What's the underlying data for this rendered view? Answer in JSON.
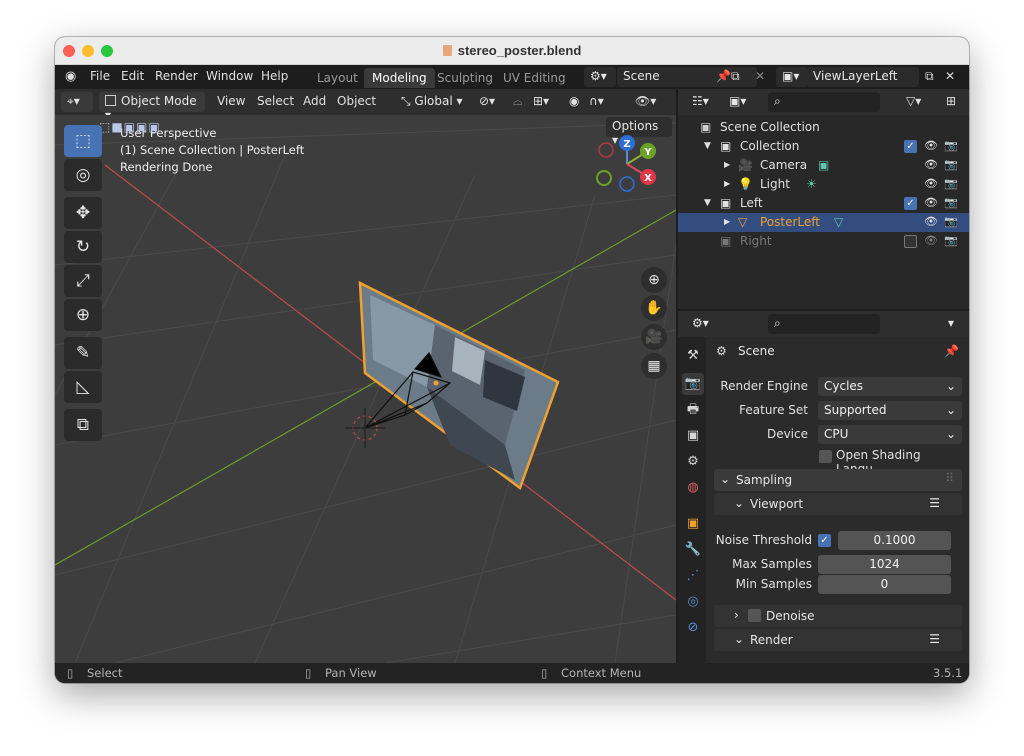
{
  "window": {
    "title": "stereo_poster.blend"
  },
  "menubar": [
    "File",
    "Edit",
    "Render",
    "Window",
    "Help"
  ],
  "workspaces": [
    {
      "label": "Layout",
      "active": false
    },
    {
      "label": "Modeling",
      "active": true
    },
    {
      "label": "Sculpting",
      "active": false
    },
    {
      "label": "UV Editing",
      "active": false
    }
  ],
  "scene_field": "Scene",
  "view_layer_field": "ViewLayerLeft",
  "viewport_header": {
    "mode": "Object Mode",
    "menus": [
      "View",
      "Select",
      "Add",
      "Object"
    ],
    "transform": "Global",
    "options": "Options"
  },
  "viewport_overlay": {
    "line1": "User Perspective",
    "line2": "(1) Scene Collection | PosterLeft",
    "line3": "Rendering Done"
  },
  "gizmo": {
    "x": "X",
    "y": "Y",
    "z": "Z"
  },
  "outliner": {
    "root": "Scene Collection",
    "rows": [
      {
        "label": "Collection"
      },
      {
        "label": "Camera"
      },
      {
        "label": "Light"
      },
      {
        "label": "Left"
      },
      {
        "label": "PosterLeft"
      },
      {
        "label": "Right"
      }
    ]
  },
  "properties": {
    "context": "Scene",
    "render_engine_label": "Render Engine",
    "render_engine": "Cycles",
    "feature_set_label": "Feature Set",
    "feature_set": "Supported",
    "device_label": "Device",
    "device": "CPU",
    "osl_label": "Open Shading Langu...",
    "sampling": "Sampling",
    "viewport": "Viewport",
    "noise_threshold_label": "Noise Threshold",
    "noise_threshold": "0.1000",
    "max_samples_label": "Max Samples",
    "max_samples": "1024",
    "min_samples_label": "Min Samples",
    "min_samples": "0",
    "denoise": "Denoise",
    "render": "Render"
  },
  "status": {
    "select": "Select",
    "pan": "Pan View",
    "context": "Context Menu",
    "version": "3.5.1"
  },
  "colors": {
    "accent": "#4772b3",
    "selection_orange": "#f0a030",
    "x_axis": "#c14a4a",
    "y_axis": "#6b9a2a"
  }
}
